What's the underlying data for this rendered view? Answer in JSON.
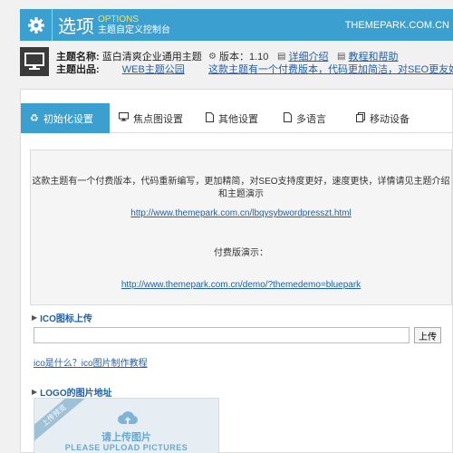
{
  "header": {
    "title": "选项",
    "subtitle_en": "OPTIONS",
    "subtitle_cn": "主题自定义控制台",
    "site": "THEMEPARK.COM.CN"
  },
  "info": {
    "theme_name_label": "主题名称:",
    "theme_name": "蓝白清爽企业通用主题",
    "theme_from_label": "主题出品:",
    "theme_from": "WEB主题公园",
    "version": "版本：1.10",
    "details_link": "详细介绍",
    "help_link": "教程和帮助",
    "promo_link": "这款主题有一个付费版本，代码更加简洁，对SEO更友好"
  },
  "tabs": [
    {
      "label": "初始化设置",
      "icon": "recycle-icon"
    },
    {
      "label": "焦点图设置",
      "icon": "monitor-icon"
    },
    {
      "label": "其他设置",
      "icon": "document-icon"
    },
    {
      "label": "多语言",
      "icon": "document-icon"
    },
    {
      "label": "移动设备",
      "icon": "copy-icon"
    }
  ],
  "notice": {
    "text1": "这款主题有一个付费版本，代码重新编写，更加精简，对SEO支持度更好，速度更快，详情请见主题介绍和主题演示",
    "link1": "http://www.themepark.com.cn/lbqysybwordpresszt.html",
    "text2": "付费版演示：",
    "link2": "http://www.themepark.com.cn/demo/?themedemo=bluepark"
  },
  "ico": {
    "title": "ICO图标上传",
    "input_value": "",
    "upload_label": "上传",
    "help_link": "ico是什么？ico图片制作教程"
  },
  "logo": {
    "title": "LOGO的图片地址",
    "ribbon": "上传预览",
    "upload_cn": "请上传图片",
    "upload_en": "PLEASE UPLOAD PICTURES"
  },
  "colors": {
    "accent": "#3b9fd0",
    "link": "#1f5fb0",
    "highlight": "#ffe24a"
  }
}
